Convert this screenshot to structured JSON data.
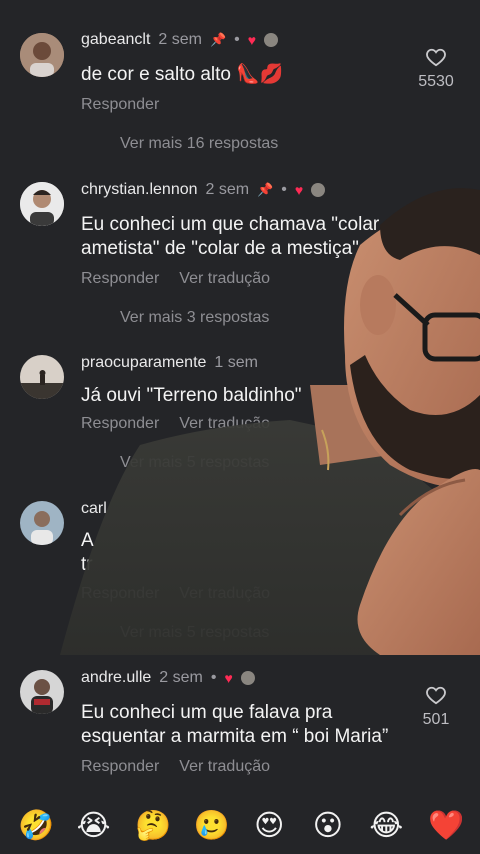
{
  "comments": [
    {
      "username": "gabeanclt",
      "time": "2 sem",
      "pinned": true,
      "text": "de cor e salto alto 👠💋",
      "actions": [
        "Responder"
      ],
      "more": "Ver mais 16 respostas",
      "likes": "5530"
    },
    {
      "username": "chrystian.lennon",
      "time": "2 sem",
      "pinned": true,
      "text": "Eu conheci um que chamava \"colar de ametista\" de \"colar de a mestiça\"",
      "actions": [
        "Responder",
        "Ver tradução"
      ],
      "more": "Ver mais 3 respostas"
    },
    {
      "username": "praocuparamente",
      "time": "1 sem",
      "text": "Já ouvi \"Terreno baldinho\"",
      "actions": [
        "Responder",
        "Ver tradução"
      ],
      "more": "Ver mais 5 respostas"
    },
    {
      "username": "carl",
      "text": "A",
      "text2": "tr",
      "actions": [
        "Responder",
        "Ver tradução"
      ],
      "more": "Ver mais 5 respostas"
    },
    {
      "username": "andre.ulle",
      "time": "2 sem",
      "text": "Eu conheci um que falava pra esquentar a marmita em “ boi Maria”",
      "actions": [
        "Responder",
        "Ver tradução"
      ],
      "likes": "501"
    }
  ],
  "emojis": [
    "🤣",
    "😭",
    "🤔",
    "🥲",
    "😍",
    "😮",
    "😂",
    "❤️"
  ],
  "colors": {
    "background": "#242528",
    "heart": "#ff2b55",
    "muted": "#8e8e93"
  }
}
